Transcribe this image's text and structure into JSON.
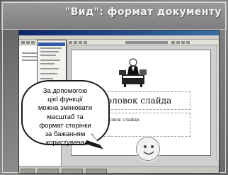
{
  "slide": {
    "title": "\"Вид\": формат документу",
    "bubble_lines": [
      "За допомогою",
      "цієї функції",
      "можна змінювати",
      "масштаб та",
      "формат сторінки",
      "за бажанням",
      "користувача"
    ]
  },
  "app": {
    "page": {
      "title_placeholder": "Заголовок слайда",
      "subtitle_placeholder": "Подзаголовок слайда"
    }
  },
  "colors": {
    "frame": "#7e7e7e",
    "title_bar": "#0a246a",
    "menu_highlight": "#315ba8",
    "bubble_border": "#1a1a1a"
  }
}
